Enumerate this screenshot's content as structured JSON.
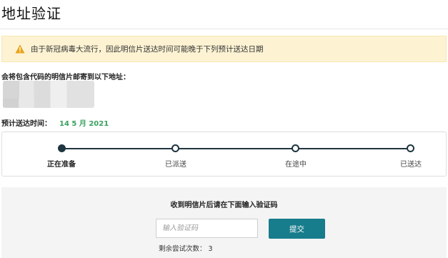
{
  "page": {
    "title": "地址验证"
  },
  "banner": {
    "icon": "warning-icon",
    "icon_color": "#e8a317",
    "background": "#fdf3d3",
    "text": "由于新冠病毒大流行，因此明信片送达时间可能晚于下列预计送达日期"
  },
  "address": {
    "label": "会将包含代码的明信片邮寄到以下地址："
  },
  "estimate": {
    "label": "预计送达时间：",
    "date": "14 5 月 2021",
    "date_color": "#3aa15e"
  },
  "progress": {
    "current_step": 0,
    "color": "#1f3540",
    "steps": [
      {
        "label": "正在准备"
      },
      {
        "label": "已派送"
      },
      {
        "label": "在途中"
      },
      {
        "label": "已送达"
      }
    ]
  },
  "verify": {
    "title": "收到明信片后请在下面输入验证码",
    "input_placeholder": "输入验证码",
    "input_value": "",
    "submit_label": "提交",
    "submit_color": "#177c8c",
    "attempts_text": "剩余尝试次数： 3"
  }
}
